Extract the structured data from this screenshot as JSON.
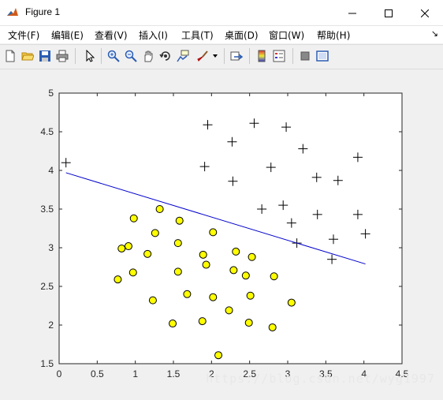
{
  "window": {
    "title": "Figure 1",
    "icon": "matlab-icon",
    "controls": [
      "minimize-icon",
      "maximize-icon",
      "close-icon"
    ]
  },
  "menu": [
    {
      "label": "文件(F)"
    },
    {
      "label": "编辑(E)"
    },
    {
      "label": "查看(V)"
    },
    {
      "label": "插入(I)"
    },
    {
      "label": "工具(T)"
    },
    {
      "label": "桌面(D)"
    },
    {
      "label": "窗口(W)"
    },
    {
      "label": "帮助(H)"
    }
  ],
  "toolbar": [
    "new-figure-icon",
    "open-file-icon",
    "save-icon",
    "print-icon",
    "edit-plot-icon",
    "zoom-in-icon",
    "zoom-out-icon",
    "pan-icon",
    "rotate-3d-icon",
    "data-cursor-icon",
    "brush-icon",
    "link-plot-icon",
    "insert-colorbar-icon",
    "insert-legend-icon",
    "hide-plot-tools-icon",
    "show-plot-tools-icon"
  ],
  "watermark": "https://blog.csdn.net/wyg1997",
  "chart_data": {
    "type": "scatter",
    "title": "",
    "xlabel": "",
    "ylabel": "",
    "xlim": [
      0,
      4.5
    ],
    "ylim": [
      1.5,
      5
    ],
    "xticks": [
      0,
      0.5,
      1,
      1.5,
      2,
      2.5,
      3,
      3.5,
      4,
      4.5
    ],
    "yticks": [
      1.5,
      2,
      2.5,
      3,
      3.5,
      4,
      4.5,
      5
    ],
    "grid": false,
    "series": [
      {
        "marker": "plus",
        "color": "#000000",
        "x": [
          0.09,
          1.95,
          2.27,
          2.56,
          2.98,
          3.2,
          1.91,
          2.78,
          3.38,
          3.92,
          2.28,
          3.66,
          2.66,
          2.94,
          3.05,
          3.39,
          3.92,
          4.02,
          3.6,
          3.12,
          3.58
        ],
        "y": [
          4.1,
          4.59,
          4.37,
          4.61,
          4.56,
          4.28,
          4.05,
          4.04,
          3.91,
          4.17,
          3.86,
          3.87,
          3.5,
          3.55,
          3.32,
          3.43,
          3.43,
          3.18,
          3.11,
          3.06,
          2.85
        ]
      },
      {
        "marker": "circle",
        "color": "#ffff00",
        "edgecolor": "#000000",
        "x": [
          0.98,
          1.32,
          1.58,
          0.91,
          0.82,
          1.26,
          2.02,
          1.56,
          1.16,
          1.89,
          2.32,
          2.53,
          1.93,
          0.97,
          1.56,
          2.29,
          2.45,
          2.82,
          0.77,
          1.68,
          2.02,
          2.51,
          3.05,
          1.23,
          2.23,
          1.88,
          1.49,
          2.49,
          2.8,
          2.09
        ],
        "y": [
          3.38,
          3.5,
          3.35,
          3.02,
          2.99,
          3.19,
          3.2,
          3.06,
          2.92,
          2.91,
          2.95,
          2.88,
          2.78,
          2.68,
          2.69,
          2.71,
          2.64,
          2.63,
          2.59,
          2.4,
          2.36,
          2.38,
          2.29,
          2.32,
          2.19,
          2.05,
          2.02,
          2.03,
          1.97,
          1.61
        ]
      },
      {
        "type": "line",
        "color": "#0000cc",
        "x": [
          0.09,
          4.02
        ],
        "y": [
          3.97,
          2.79
        ]
      }
    ]
  }
}
